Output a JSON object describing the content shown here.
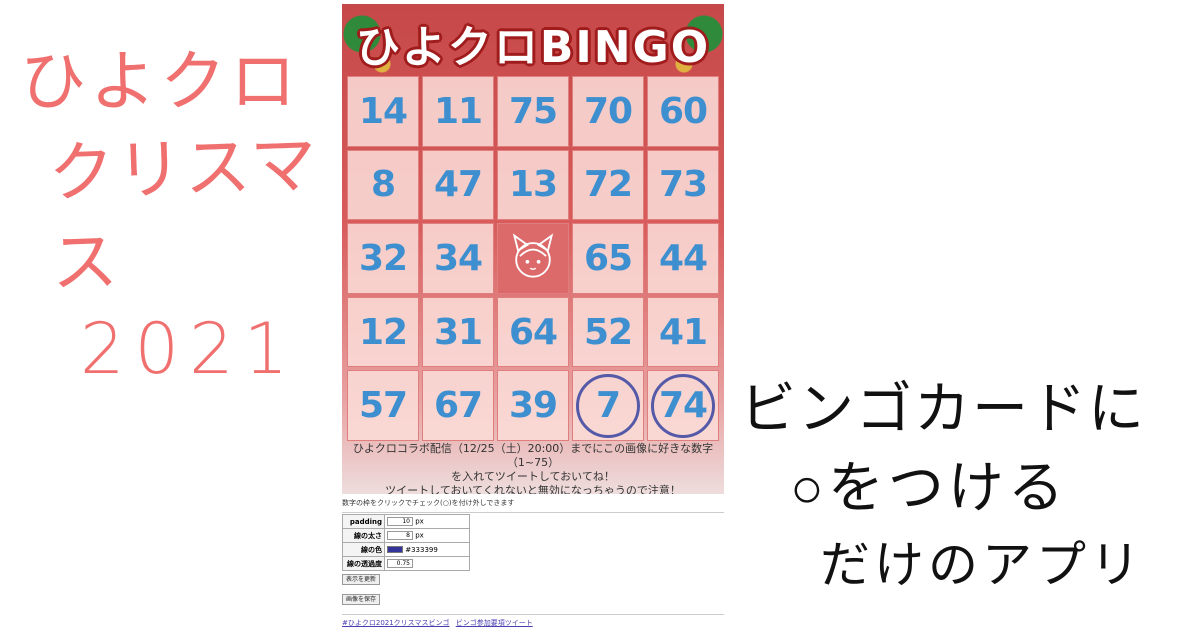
{
  "hand_left": {
    "line1": "ひよクロ",
    "line2": "クリスマス",
    "line3": "2021"
  },
  "hand_right": {
    "line1": "ビンゴカードに",
    "line2": "○をつける",
    "line3": "だけのアプリ"
  },
  "card": {
    "logo": "ひよクロBINGO",
    "cells": [
      {
        "value": "14",
        "marked": false
      },
      {
        "value": "11",
        "marked": false
      },
      {
        "value": "75",
        "marked": false
      },
      {
        "value": "70",
        "marked": false
      },
      {
        "value": "60",
        "marked": false
      },
      {
        "value": "8",
        "marked": false
      },
      {
        "value": "47",
        "marked": false
      },
      {
        "value": "13",
        "marked": false
      },
      {
        "value": "72",
        "marked": false
      },
      {
        "value": "73",
        "marked": false
      },
      {
        "value": "32",
        "marked": false
      },
      {
        "value": "34",
        "marked": false
      },
      {
        "value": "",
        "marked": false,
        "free": true
      },
      {
        "value": "65",
        "marked": false
      },
      {
        "value": "44",
        "marked": false
      },
      {
        "value": "12",
        "marked": false
      },
      {
        "value": "31",
        "marked": false
      },
      {
        "value": "64",
        "marked": false
      },
      {
        "value": "52",
        "marked": false
      },
      {
        "value": "41",
        "marked": false
      },
      {
        "value": "57",
        "marked": false
      },
      {
        "value": "67",
        "marked": false
      },
      {
        "value": "39",
        "marked": false
      },
      {
        "value": "7",
        "marked": true
      },
      {
        "value": "74",
        "marked": true
      }
    ],
    "notice_line1": "ひよクロコラボ配信（12/25（土）20:00）までにこの画像に好きな数字（1~75）",
    "notice_line2": "を入れてツイートしておいてね！",
    "notice_line3": "ツイートしておいてくれないと無効になっちゃうので注意！"
  },
  "controls": {
    "hint": "数字の枠をクリックでチェック(○)を付け外しできます",
    "padding_label": "padding",
    "padding_value": "10",
    "padding_unit": "px",
    "width_label": "線の太さ",
    "width_value": "8",
    "width_unit": "px",
    "color_label": "線の色",
    "color_value": "#333399",
    "opacity_label": "線の透過度",
    "opacity_value": "0.75",
    "refresh_button": "表示を更新",
    "save_button": "画像を保存"
  },
  "footer": {
    "link1": "#ひよクロ2021クリスマスビンゴ",
    "link2": "ビンゴ参加要項ツイート"
  },
  "colors": {
    "accent_red": "#c64848",
    "number_blue": "#3d8fcf",
    "mark_purple": "#555aa8",
    "hand_pink": "#f07070"
  }
}
